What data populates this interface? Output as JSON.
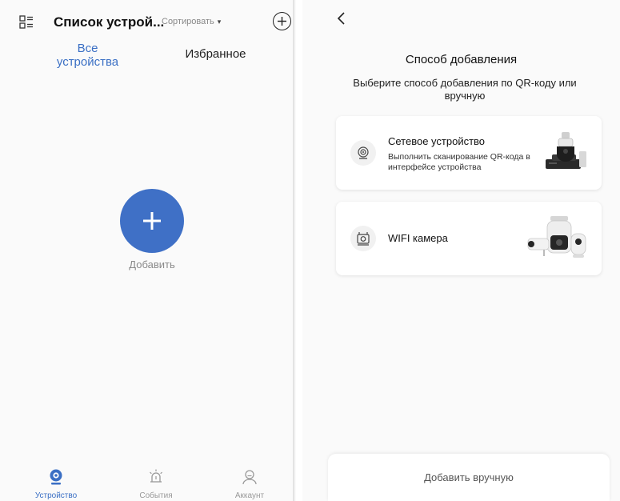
{
  "device_list": {
    "header": {
      "title": "Список устрой...",
      "sort_label": "Сортировать",
      "sort_caret": "▾"
    },
    "tabs": [
      {
        "label": "Все устройства",
        "selected": true
      },
      {
        "label": "Избранное",
        "selected": false
      }
    ],
    "add_label": "Добавить",
    "bottom_nav": [
      {
        "label": "Устройство",
        "icon": "camera-icon",
        "active": true
      },
      {
        "label": "События",
        "icon": "alarm-icon",
        "active": false
      },
      {
        "label": "Аккаунт",
        "icon": "user-icon",
        "active": false
      }
    ]
  },
  "add_method": {
    "title": "Способ добавления",
    "subtitle": "Выберите способ добавления по QR-коду или вручную",
    "options": [
      {
        "title": "Сетевое устройство",
        "description": "Выполнить сканирование QR-кода в интерфейсе устройства",
        "icon": "network-device-icon"
      },
      {
        "title": "WIFI камера",
        "icon": "wifi-camera-icon"
      }
    ],
    "manual_button": "Добавить вручную"
  },
  "colors": {
    "accent": "#3f70c6",
    "tab_active": "#3a6fc4",
    "muted": "#999999"
  }
}
